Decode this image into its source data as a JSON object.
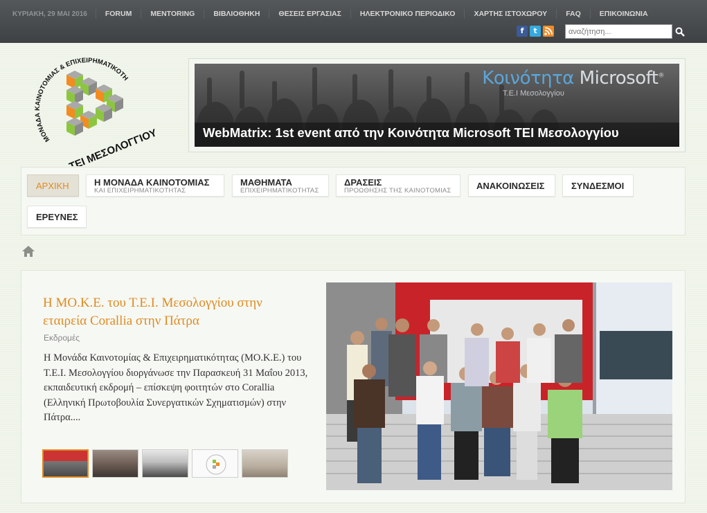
{
  "topbar": {
    "date": "ΚΥΡΙΑΚΗ, 29 ΜΑΙ 2016",
    "items": [
      "FORUM",
      "MENTORING",
      "ΒΙΒΛΙΟΘΗΚΗ",
      "ΘΕΣΕΙΣ ΕΡΓΑΣΙΑΣ",
      "ΗΛΕΚΤΡΟΝΙΚΟ ΠΕΡΙΟΔΙΚΟ",
      "ΧΑΡΤΗΣ ΙΣΤΟΧΩΡΟΥ",
      "FAQ",
      "ΕΠΙΚΟΙΝΩΝΙΑ"
    ],
    "search_placeholder": "αναζήτηση...",
    "social": {
      "facebook": "f",
      "twitter": "t",
      "rss": "rss"
    }
  },
  "logo": {
    "arc_text": "ΜΟΝΑΔΑ ΚΑΙΝΟΤΟΜΙΑΣ & ΕΠΙΧΕΙΡΗΜΑΤΙΚΟΤΗΤΑΣ",
    "ribbon_text": "ΤΕΙ ΜΕΣΟΛΟΓΓΙΟΥ"
  },
  "banner": {
    "brand_prefix": "Κοινότητα ",
    "brand_name": "Microsoft",
    "brand_mark": "®",
    "subtitle": "Τ.Ε.Ι Μεσολογγίου",
    "caption": "WebMatrix: 1st event από την Κοινότητα Microsoft ΤΕΙ Μεσολογγίου"
  },
  "mainnav": {
    "home": {
      "label": "ΑΡΧΙΚΗ"
    },
    "unit": {
      "label": "Η ΜΟΝΑΔΑ ΚΑΙΝΟΤΟΜΙΑΣ",
      "sub": "ΚΑΙ ΕΠΙΧΕΙΡΗΜΑΤΙΚΟΤΗΤΑΣ"
    },
    "courses": {
      "label": "ΜΑΘΗΜΑΤΑ",
      "sub": "ΕΠΙΧΕΙΡΗΜΑΤΙΚΟΤΗΤΑΣ"
    },
    "actions": {
      "label": "ΔΡΑΣΕΙΣ",
      "sub": "ΠΡΟΩΘΗΣΗΣ ΤΗΣ ΚΑΙΝΟΤΟΜΙΑΣ"
    },
    "announcements": {
      "label": "ΑΝΑΚΟΙΝΩΣΕΙΣ"
    },
    "links": {
      "label": "ΣΥΝΔΕΣΜΟΙ"
    },
    "research": {
      "label": "ΕΡΕΥΝΕΣ"
    }
  },
  "featured": {
    "title": "Η ΜΟ.Κ.Ε. του Τ.Ε.Ι. Μεσολογγίου στην εταιρεία Corallia στην Πάτρα",
    "category": "Εκδρομές",
    "text": "Η Μονάδα Καινοτομίας & Επιχειρηματικότητας (ΜΟ.Κ.Ε.) του Τ.Ε.Ι. Μεσολογγίου διοργάνωσε την Παρασκευή 31 Μαΐου 2013, εκπαιδευτική εκδρομή – επίσκεψη φοιτητών στο Corallia (Ελληνική Πρωτοβουλία Συνεργατικών Σχηματισμών) στην Πάτρα...."
  },
  "colors": {
    "accent": "#e08a20",
    "topbar": "#4a4d4f",
    "background": "#eef3e8"
  },
  "icons": [
    "search-icon",
    "home-icon",
    "facebook-icon",
    "twitter-icon",
    "rss-icon"
  ]
}
